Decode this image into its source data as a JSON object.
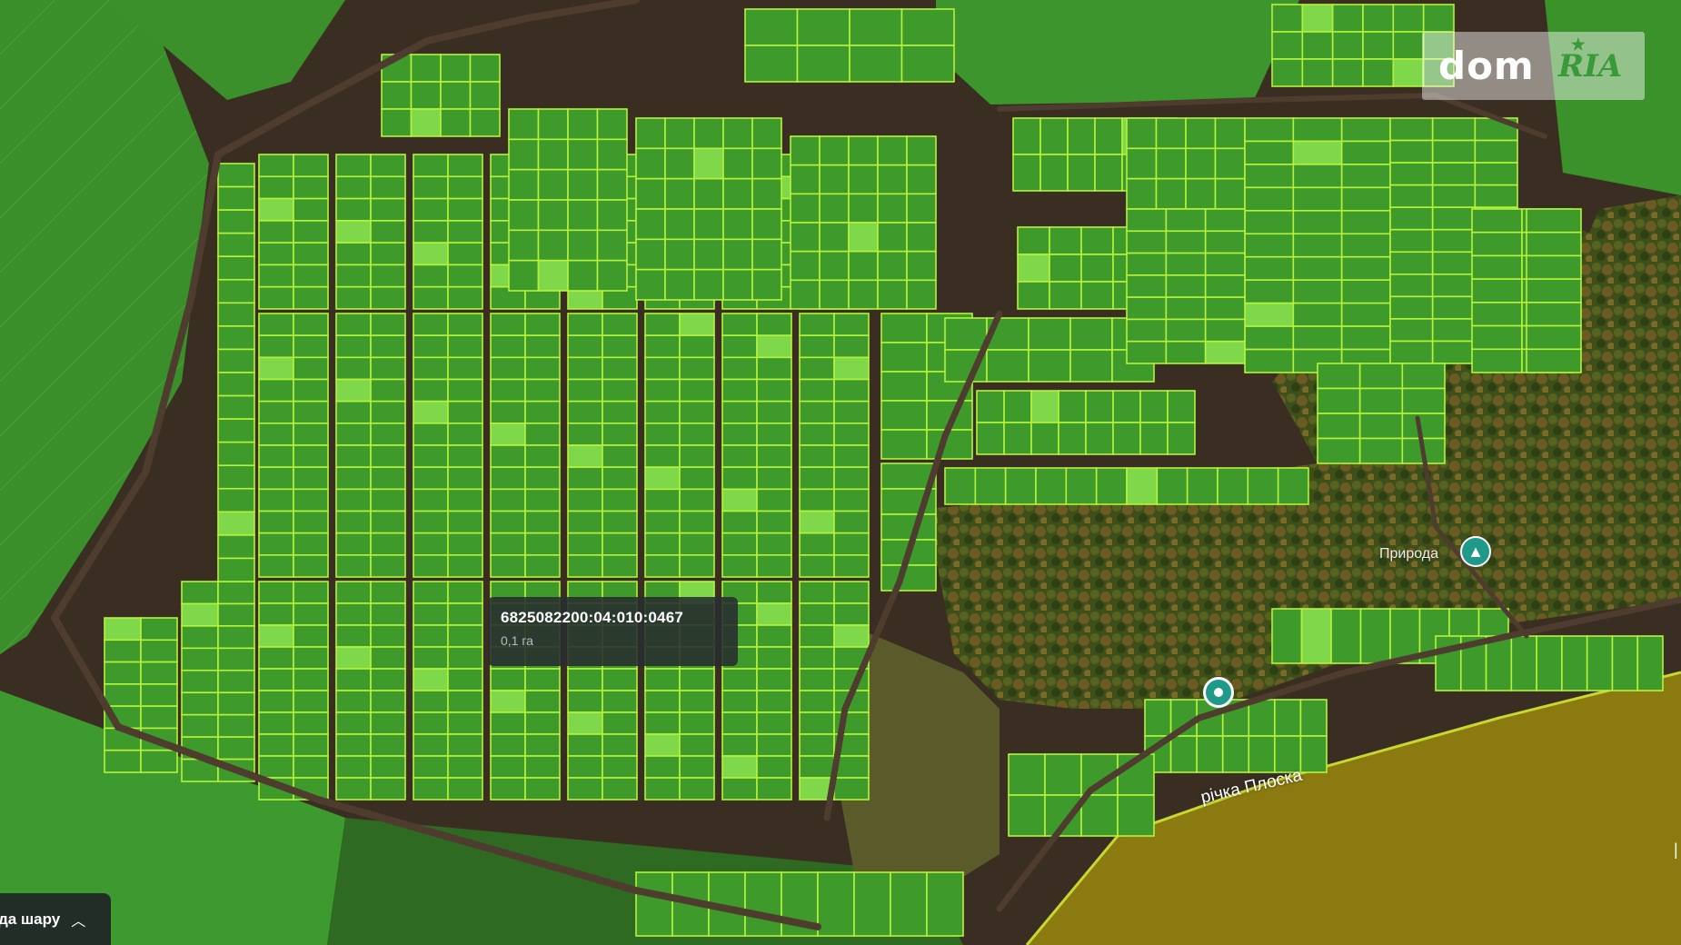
{
  "map": {
    "theme_colors": {
      "parcel_fill": "#3f9a2c",
      "parcel_border": "#b6f23a",
      "parcel_highlight": "#7fd84a",
      "forest": "#4a5a1e",
      "road": "#4b3a2c",
      "water_zone": "#8a7a10"
    }
  },
  "tooltip": {
    "cadastral_number": "6825082200:04:010:0467",
    "area": "0,1 га"
  },
  "logo": {
    "dom": "dom",
    "ria": "RIA"
  },
  "poi": {
    "label": "Природа",
    "icon": "tree-icon"
  },
  "marker": {
    "icon": "location-pin-icon"
  },
  "river": {
    "label": "річка Плоска"
  },
  "layer_toggle": {
    "label": "да шару",
    "icon": "chevron-up-icon"
  }
}
